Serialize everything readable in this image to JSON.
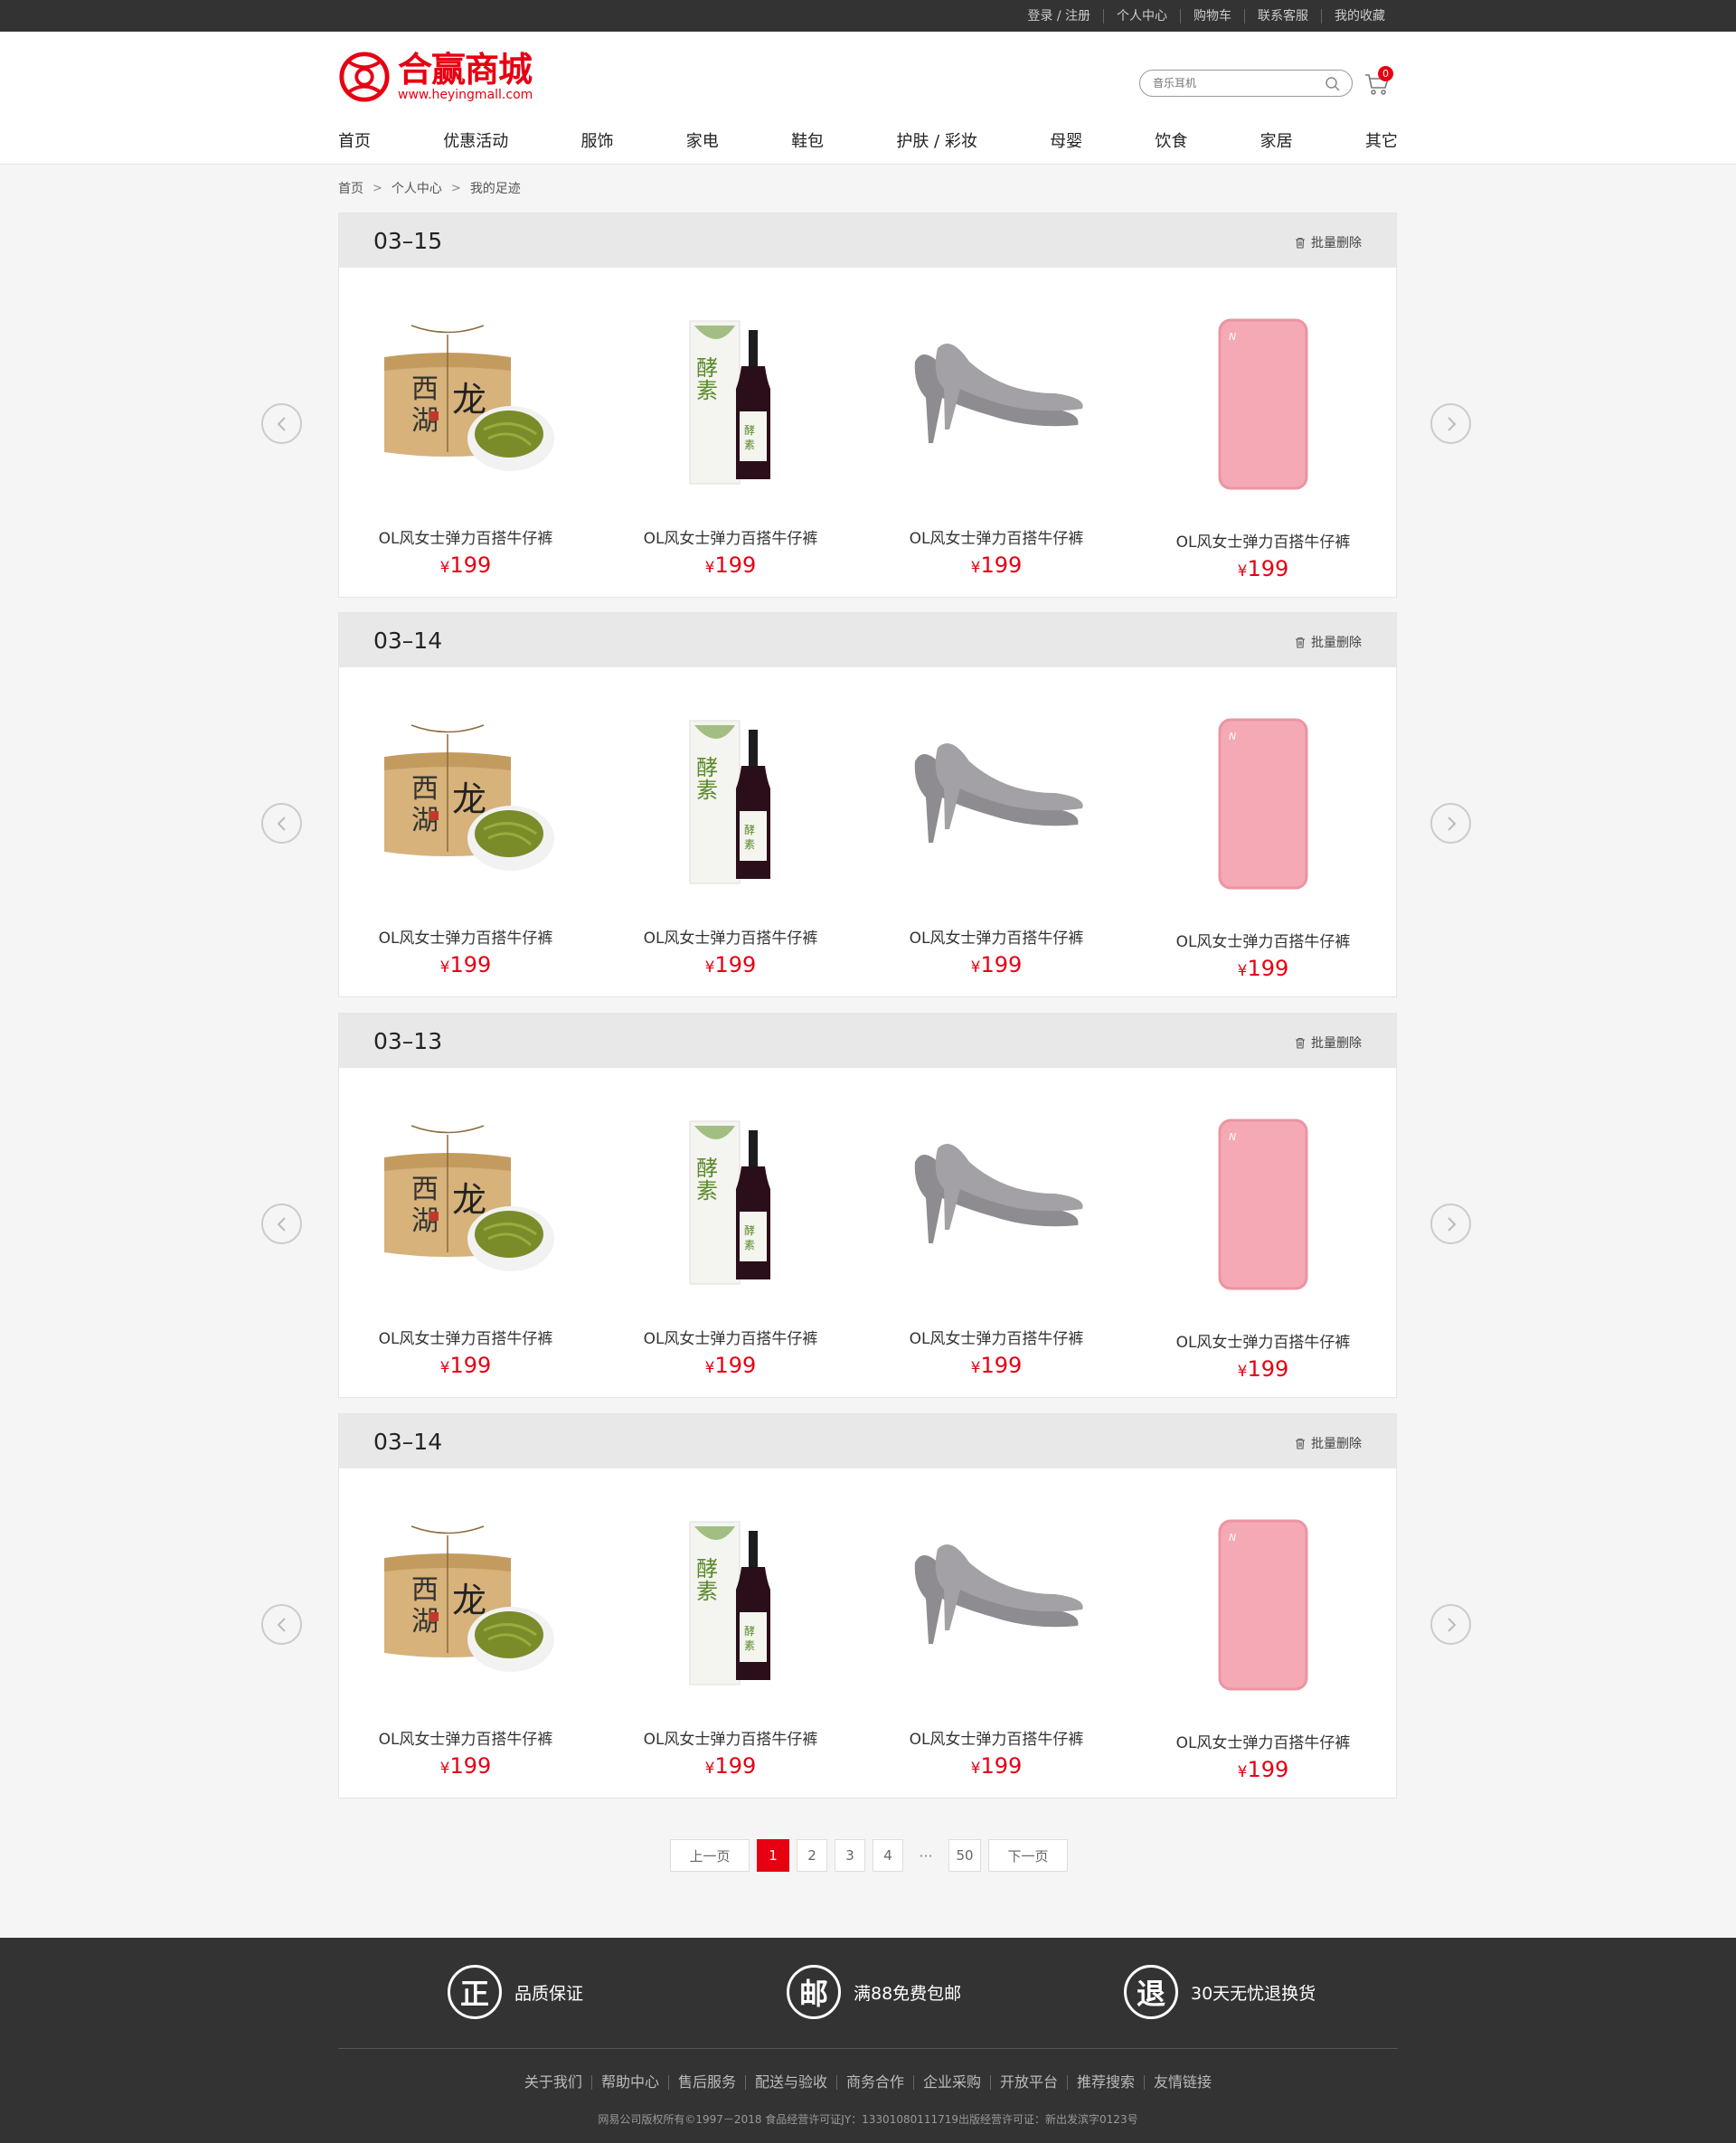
{
  "topbar": {
    "links": [
      "登录 / 注册",
      "个人中心",
      "购物车",
      "联系客服",
      "我的收藏"
    ]
  },
  "header": {
    "logo_name": "合赢商城",
    "logo_url": "www.heyingmall.com",
    "search_placeholder": "音乐耳机",
    "cart_count": "0",
    "nav": [
      "首页",
      "优惠活动",
      "服饰",
      "家电",
      "鞋包",
      "护肤 / 彩妆",
      "母婴",
      "饮食",
      "家居",
      "其它"
    ]
  },
  "breadcrumb": [
    "首页",
    "个人中心",
    "我的足迹"
  ],
  "sections": [
    {
      "date": "03–15",
      "delete_label": "批量删除",
      "products": [
        {
          "name": "OL风女士弹力百搭牛仔裤",
          "currency": "¥",
          "price": "199",
          "image": "tea-icon"
        },
        {
          "name": "OL风女士弹力百搭牛仔裤",
          "currency": "¥",
          "price": "199",
          "image": "wine-bottle-icon"
        },
        {
          "name": "OL风女士弹力百搭牛仔裤",
          "currency": "¥",
          "price": "199",
          "image": "heels-icon"
        },
        {
          "name": "OL风女士弹力百搭牛仔裤",
          "currency": "¥",
          "price": "199",
          "image": "power-bank-icon"
        }
      ]
    },
    {
      "date": "03–14",
      "delete_label": "批量删除",
      "products": [
        {
          "name": "OL风女士弹力百搭牛仔裤",
          "currency": "¥",
          "price": "199",
          "image": "tea-icon"
        },
        {
          "name": "OL风女士弹力百搭牛仔裤",
          "currency": "¥",
          "price": "199",
          "image": "wine-bottle-icon"
        },
        {
          "name": "OL风女士弹力百搭牛仔裤",
          "currency": "¥",
          "price": "199",
          "image": "heels-icon"
        },
        {
          "name": "OL风女士弹力百搭牛仔裤",
          "currency": "¥",
          "price": "199",
          "image": "power-bank-icon"
        }
      ]
    },
    {
      "date": "03–13",
      "delete_label": "批量删除",
      "products": [
        {
          "name": "OL风女士弹力百搭牛仔裤",
          "currency": "¥",
          "price": "199",
          "image": "tea-icon"
        },
        {
          "name": "OL风女士弹力百搭牛仔裤",
          "currency": "¥",
          "price": "199",
          "image": "wine-bottle-icon"
        },
        {
          "name": "OL风女士弹力百搭牛仔裤",
          "currency": "¥",
          "price": "199",
          "image": "heels-icon"
        },
        {
          "name": "OL风女士弹力百搭牛仔裤",
          "currency": "¥",
          "price": "199",
          "image": "power-bank-icon"
        }
      ]
    },
    {
      "date": "03–14",
      "delete_label": "批量删除",
      "products": [
        {
          "name": "OL风女士弹力百搭牛仔裤",
          "currency": "¥",
          "price": "199",
          "image": "tea-icon"
        },
        {
          "name": "OL风女士弹力百搭牛仔裤",
          "currency": "¥",
          "price": "199",
          "image": "wine-bottle-icon"
        },
        {
          "name": "OL风女士弹力百搭牛仔裤",
          "currency": "¥",
          "price": "199",
          "image": "heels-icon"
        },
        {
          "name": "OL风女士弹力百搭牛仔裤",
          "currency": "¥",
          "price": "199",
          "image": "power-bank-icon"
        }
      ]
    }
  ],
  "pagination": {
    "prev": "上一页",
    "pages": [
      "1",
      "2",
      "3",
      "4"
    ],
    "ellipsis": "···",
    "last": "50",
    "next": "下一页",
    "current": "1"
  },
  "footer": {
    "promises": [
      {
        "icon_char": "正",
        "text": "品质保证"
      },
      {
        "icon_char": "邮",
        "text": "满88免费包邮"
      },
      {
        "icon_char": "退",
        "text": "30天无忧退换货"
      }
    ],
    "links": [
      "关于我们",
      "帮助中心",
      "售后服务",
      "配送与验收",
      "商务合作",
      "企业采购",
      "开放平台",
      "推荐搜索",
      "友情链接"
    ],
    "copyright": "网易公司版权所有©1997－2018   食品经营许可证JY：13301080111719出版经营许可证：新出发滨字0123号"
  },
  "colors": {
    "brand_red": "#e60012",
    "topbar_bg": "#333333",
    "page_bg": "#f5f5f5",
    "section_head_bg": "#e8e8e8"
  }
}
